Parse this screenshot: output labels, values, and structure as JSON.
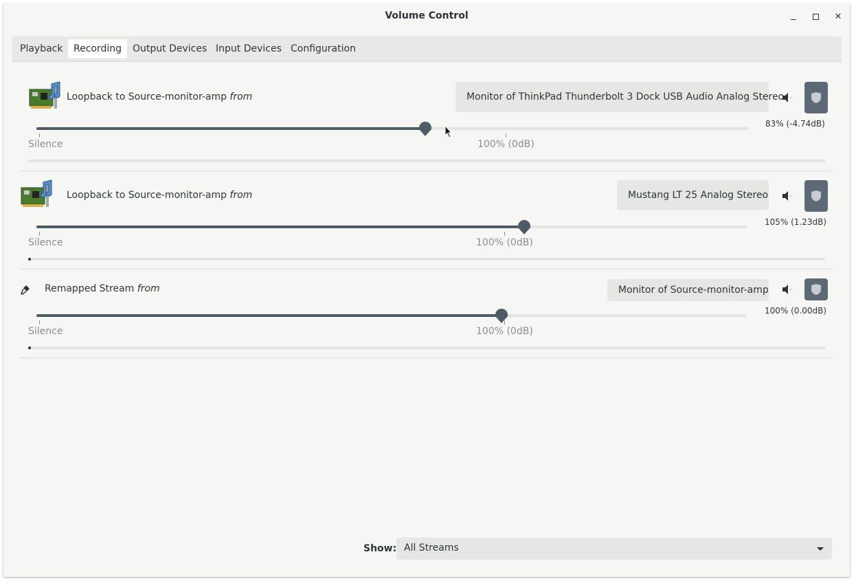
{
  "window": {
    "title": "Volume Control"
  },
  "tabs": [
    {
      "label": "Playback"
    },
    {
      "label": "Recording",
      "active": true
    },
    {
      "label": "Output Devices"
    },
    {
      "label": "Input Devices"
    },
    {
      "label": "Configuration"
    }
  ],
  "streams": [
    {
      "name": "Loopback to Source-monitor-amp",
      "connector": "from",
      "icon": "sound-card-icon",
      "device": "Monitor of ThinkPad Thunderbolt 3 Dock USB Audio Analog Stereo",
      "volume_fraction": 0.83,
      "volume_text": "83% (-4.74dB)",
      "silence_label": "Silence",
      "norm_label": "100% (0dB)",
      "peak_level": 0.0
    },
    {
      "name": "Loopback to Source-monitor-amp",
      "connector": "from",
      "icon": "sound-card-icon",
      "device": "Mustang LT 25 Analog Stereo",
      "volume_fraction": 1.05,
      "volume_text": "105% (1.23dB)",
      "silence_label": "Silence",
      "norm_label": "100% (0dB)",
      "peak_level": 0.0
    },
    {
      "name": "Remapped Stream",
      "connector": "from",
      "icon": "microphone-icon",
      "device": "Monitor of Source-monitor-amp",
      "volume_fraction": 1.0,
      "volume_text": "100% (0.00dB)",
      "silence_label": "Silence",
      "norm_label": "100% (0dB)",
      "peak_level": 0.0
    }
  ],
  "footer": {
    "show_label": "Show:",
    "show_value": "All Streams"
  },
  "colors": {
    "accent": "#4e5a64",
    "lock_button": "#5d6a75",
    "background": "#f6f6f5"
  }
}
